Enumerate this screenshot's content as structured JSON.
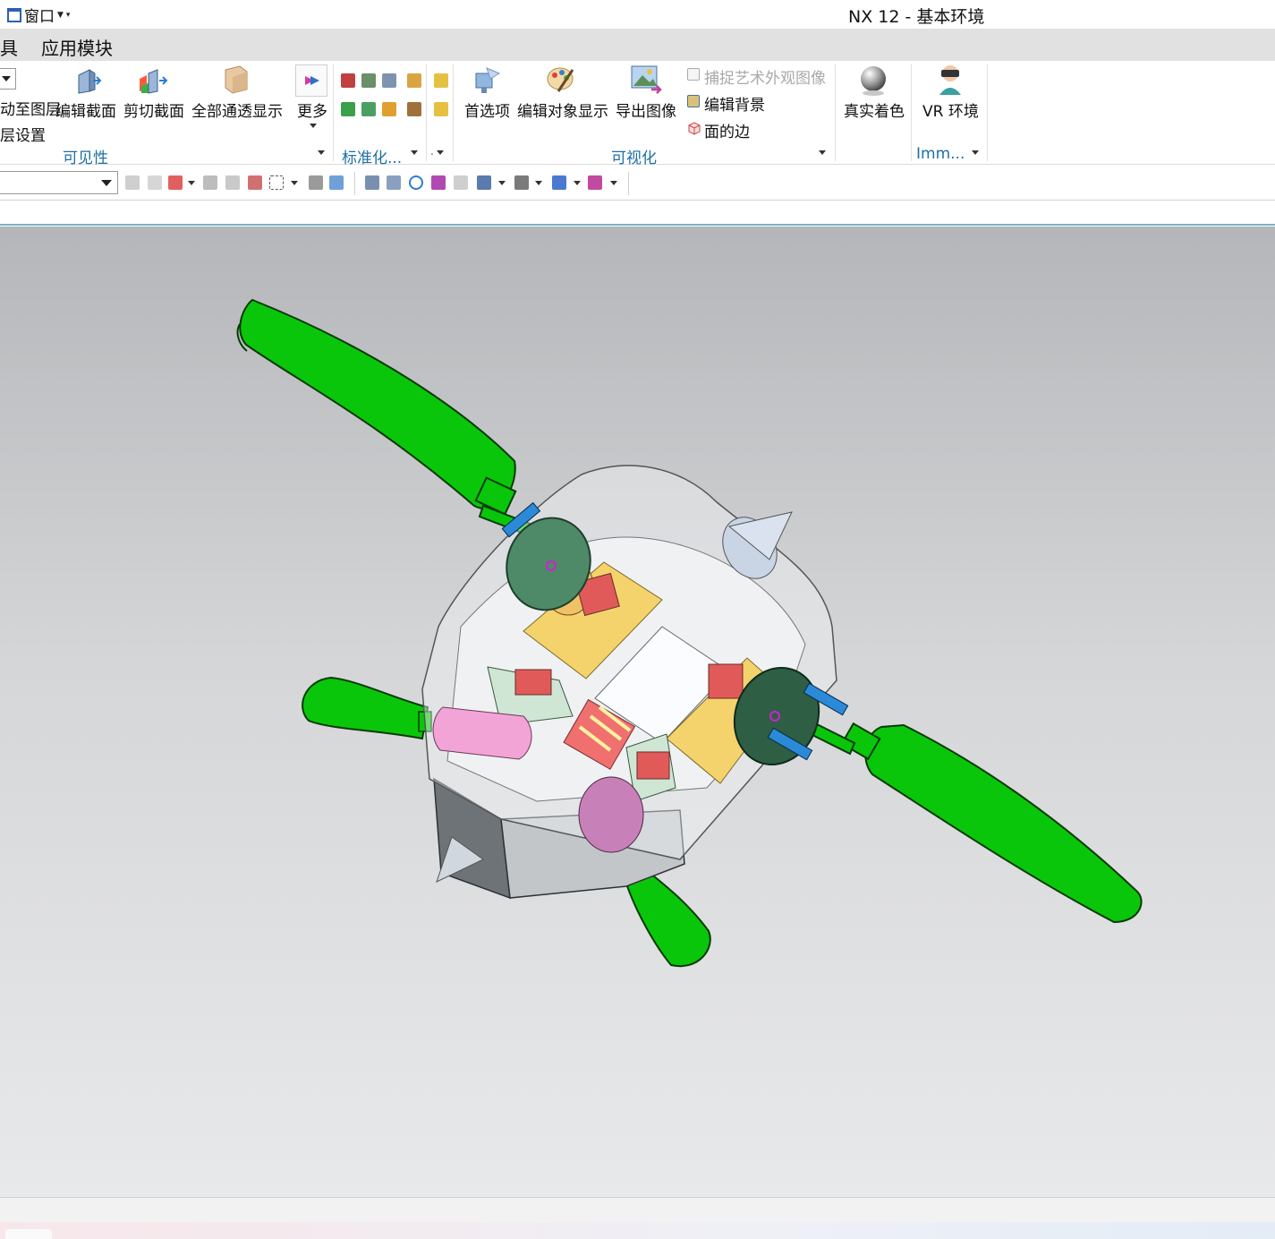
{
  "quick_access": {
    "window_label": "窗口"
  },
  "title": "NX 12 - 基本环境",
  "menubar": {
    "items": [
      "具",
      "应用模块"
    ]
  },
  "ribbon": {
    "groups": {
      "visibility": {
        "label": "可见性",
        "move_to_layer": "动至图层",
        "layer_settings": "层设置",
        "edit_section": "编辑截面",
        "clip_section": "剪切截面",
        "all_transparent": "全部通透显示",
        "more": "更多"
      },
      "standardize": {
        "label": "标准化..."
      },
      "visualization": {
        "label": "可视化",
        "preferences": "首选项",
        "edit_object_display": "编辑对象显示",
        "export_image": "导出图像",
        "capture_studio_image": "捕捉艺术外观图像",
        "edit_background": "编辑背景",
        "face_edges": "面的边",
        "true_shading": "真实着色"
      },
      "immersive": {
        "label": "Imm...",
        "vr": "VR 环境"
      }
    }
  },
  "colors": {
    "group_label": "#1d6fa5",
    "ribbon_menu_bg": "#e1e1e1",
    "highlight": "#cfe6f5",
    "model_green": "#0ac60a",
    "viewport_top": "#b4b6b9",
    "viewport_bottom": "#e8e9ea"
  },
  "icons": [
    "window-icon",
    "edit-section-icon",
    "clip-section-icon",
    "all-transparent-icon",
    "more-icon",
    "preferences-icon",
    "edit-object-display-icon",
    "export-image-icon",
    "capture-image-icon",
    "edit-background-icon",
    "face-edges-icon",
    "true-shading-icon",
    "vr-headset-icon"
  ]
}
